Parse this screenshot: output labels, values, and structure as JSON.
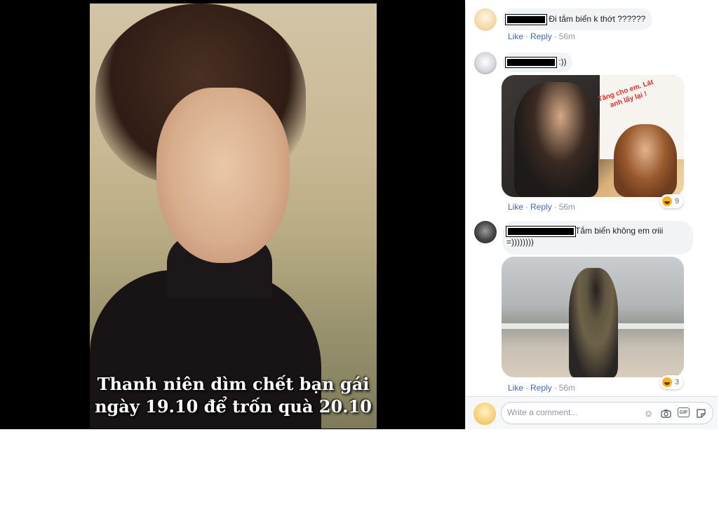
{
  "photo": {
    "caption_line1": "Thanh niên dìm chết bạn gái",
    "caption_line2": "ngày 19.10 để trốn quà 20.10"
  },
  "comments": [
    {
      "text": "Đi tắm biển k thớt ??????",
      "actions": {
        "like": "Like",
        "reply": "Reply",
        "time": "56m"
      }
    },
    {
      "text": ":))",
      "image_caption_line1": "Tăng cho em. Lát",
      "image_caption_line2": "anh lấy lại !",
      "actions": {
        "like": "Like",
        "reply": "Reply",
        "time": "56m"
      },
      "reaction": {
        "icon": "haha-reaction-icon",
        "count": "9"
      }
    },
    {
      "text_line1": "Tắm biển không em ơiii",
      "text_line2": "=))))))))",
      "actions": {
        "like": "Like",
        "reply": "Reply",
        "time": "56m"
      },
      "reaction": {
        "icon": "haha-reaction-icon",
        "count": "3"
      }
    }
  ],
  "composer": {
    "placeholder": "Write a comment...",
    "icons": [
      "emoji-icon",
      "camera-icon",
      "gif-icon",
      "sticker-icon"
    ],
    "gif_label": "GIF"
  },
  "colors": {
    "link": "#4267b2",
    "meta": "#90949c",
    "bubble": "#f2f3f5",
    "viewer_bg": "#000000"
  }
}
